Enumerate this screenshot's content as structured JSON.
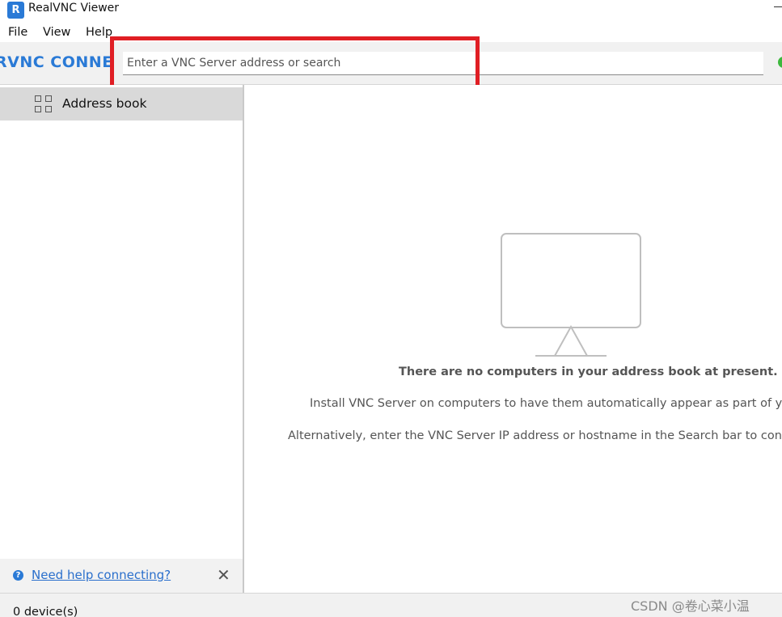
{
  "window": {
    "title": "RealVNC Viewer",
    "icon": "realvnc-app-icon",
    "icon_text": "R"
  },
  "menu": {
    "items": [
      {
        "label": "File"
      },
      {
        "label": "View"
      },
      {
        "label": "Help"
      }
    ]
  },
  "toolbar": {
    "logo_text": "RVNC CONNECT",
    "search_placeholder": "Enter a VNC Server address or search",
    "search_value": "",
    "status_color": "#3db83d",
    "highlight_color": "#e01e24"
  },
  "sidebar": {
    "items": [
      {
        "label": "Address book",
        "icon": "grid-icon",
        "selected": true
      }
    ],
    "help": {
      "icon": "help-icon",
      "icon_text": "?",
      "link_text": "Need help connecting?",
      "close_icon": "close-icon",
      "close_glyph": "✕"
    }
  },
  "main": {
    "empty_state": {
      "icon": "monitor-icon",
      "title": "There are no computers in your address book at present.",
      "line1": "Install VNC Server on computers to have them automatically appear as part of yo",
      "line2": "Alternatively, enter the VNC Server IP address or hostname in the Search bar to conn"
    }
  },
  "statusbar": {
    "device_count": "0 device(s)",
    "watermark": "CSDN @卷心菜小温"
  },
  "colors": {
    "accent": "#2a7ad6",
    "link": "#2a6fcc",
    "selected_bg": "#d9d9d9"
  }
}
